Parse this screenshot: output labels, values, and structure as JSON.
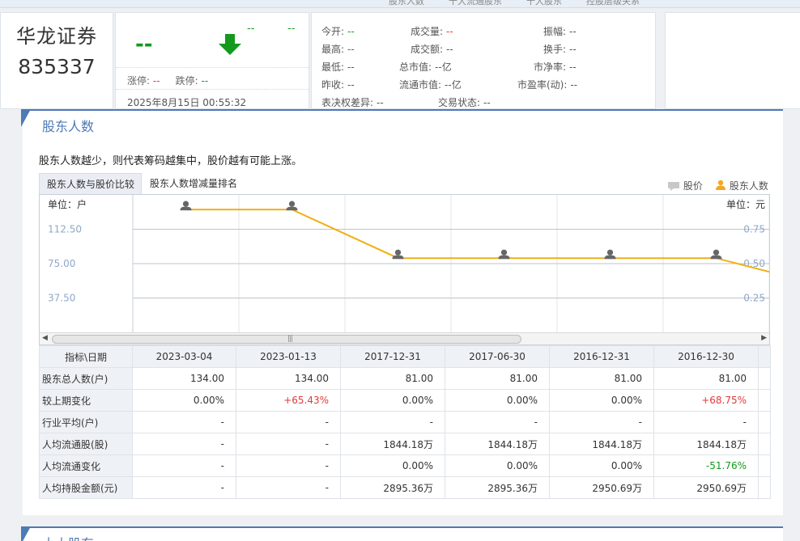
{
  "topnav": [
    "股东人数",
    "十大流通股东",
    "十大股东",
    "控股层级关系"
  ],
  "stock": {
    "name": "华龙证券",
    "code": "835337",
    "price": "--",
    "change": "--",
    "change_pct": "--",
    "limit_up_label": "涨停:",
    "limit_up": "--",
    "limit_down_label": "跌停:",
    "limit_down": "--",
    "datetime": "2025年8月15日 00:55:32"
  },
  "quote_stats": [
    {
      "label": "今开:",
      "value": "--",
      "tone": "grn"
    },
    {
      "label": "成交量:",
      "value": "--",
      "tone": "red"
    },
    {
      "label": "振幅:",
      "value": "--",
      "tone": ""
    },
    {
      "label": "最高:",
      "value": "--",
      "tone": "grn"
    },
    {
      "label": "成交额:",
      "value": "--",
      "tone": ""
    },
    {
      "label": "换手:",
      "value": "--",
      "tone": ""
    },
    {
      "label": "最低:",
      "value": "--",
      "tone": ""
    },
    {
      "label": "总市值:",
      "value": "--亿",
      "tone": ""
    },
    {
      "label": "市净率:",
      "value": "--",
      "tone": ""
    },
    {
      "label": "昨收:",
      "value": "--",
      "tone": ""
    },
    {
      "label": "流通市值:",
      "value": "--亿",
      "tone": ""
    },
    {
      "label": "市盈率(动):",
      "value": "--",
      "tone": ""
    },
    {
      "label": "表决权差异:",
      "value": "--",
      "tone": ""
    },
    {
      "label": "交易状态:",
      "value": "--",
      "tone": ""
    }
  ],
  "section": {
    "title": "股东人数",
    "description": "股东人数越少，则代表筹码越集中，股价越有可能上涨。",
    "tabs": [
      "股东人数与股价比较",
      "股东人数增减量排名"
    ],
    "legend_price": "股价",
    "legend_holders": "股东人数",
    "unit_left": "单位：户",
    "unit_right": "单位：元"
  },
  "chart_data": {
    "type": "line",
    "series": [
      {
        "name": "股东人数",
        "values": [
          134,
          134,
          81,
          81,
          81,
          81
        ],
        "color": "#f0b014"
      }
    ],
    "categories": [
      "2023-03-04",
      "2023-01-13",
      "2017-12-31",
      "2017-06-30",
      "2016-12-31",
      "2016-12-30"
    ],
    "y_ticks_left": [
      "112.50",
      "75.00",
      "37.50"
    ],
    "y_ticks_right": [
      "0.75",
      "0.50",
      "0.25"
    ],
    "ylim": [
      0,
      150
    ],
    "grid": true,
    "tail_value": 66
  },
  "table": {
    "header_label": "指标\\日期",
    "dates": [
      "2023-03-04",
      "2023-01-13",
      "2017-12-31",
      "2017-06-30",
      "2016-12-31",
      "2016-12-30"
    ],
    "rows": [
      {
        "label": "股东总人数(户)",
        "cells": [
          {
            "v": "134.00"
          },
          {
            "v": "134.00"
          },
          {
            "v": "81.00"
          },
          {
            "v": "81.00"
          },
          {
            "v": "81.00"
          },
          {
            "v": "81.00"
          }
        ]
      },
      {
        "label": "较上期变化",
        "cells": [
          {
            "v": "0.00%"
          },
          {
            "v": "+65.43%",
            "t": "red"
          },
          {
            "v": "0.00%"
          },
          {
            "v": "0.00%"
          },
          {
            "v": "0.00%"
          },
          {
            "v": "+68.75%",
            "t": "red"
          }
        ]
      },
      {
        "label": "行业平均(户)",
        "cells": [
          {
            "v": "-"
          },
          {
            "v": "-"
          },
          {
            "v": "-"
          },
          {
            "v": "-"
          },
          {
            "v": "-"
          },
          {
            "v": "-"
          }
        ]
      },
      {
        "label": "人均流通股(股)",
        "cells": [
          {
            "v": "-"
          },
          {
            "v": "-"
          },
          {
            "v": "1844.18万"
          },
          {
            "v": "1844.18万"
          },
          {
            "v": "1844.18万"
          },
          {
            "v": "1844.18万"
          }
        ]
      },
      {
        "label": "人均流通变化",
        "cells": [
          {
            "v": "-"
          },
          {
            "v": "-"
          },
          {
            "v": "0.00%"
          },
          {
            "v": "0.00%"
          },
          {
            "v": "0.00%"
          },
          {
            "v": "-51.76%",
            "t": "grn"
          }
        ]
      },
      {
        "label": "人均持股金额(元)",
        "cells": [
          {
            "v": "-"
          },
          {
            "v": "-"
          },
          {
            "v": "2895.36万"
          },
          {
            "v": "2895.36万"
          },
          {
            "v": "2950.69万"
          },
          {
            "v": "2950.69万"
          }
        ]
      }
    ]
  },
  "section2": {
    "title": "十大股东"
  }
}
